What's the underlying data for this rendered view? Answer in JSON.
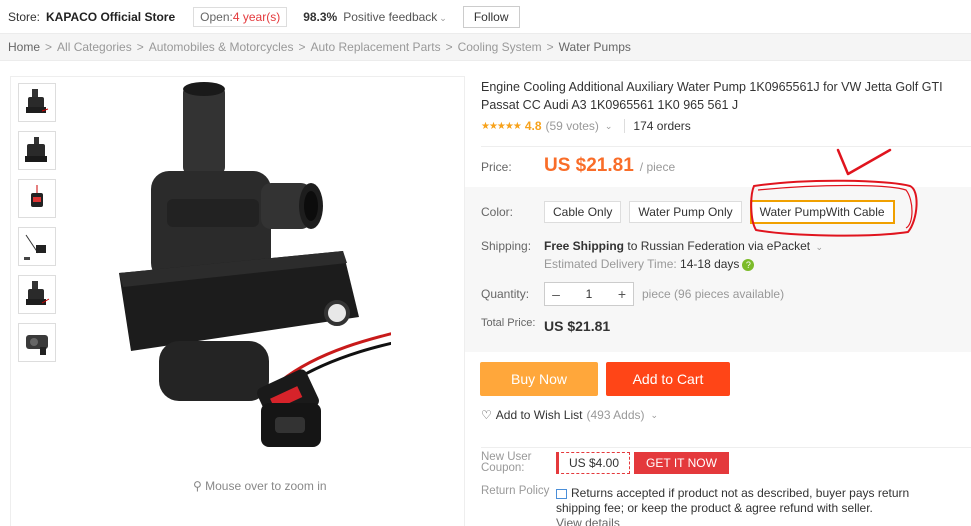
{
  "store": {
    "label": "Store:",
    "name": "KAPACO Official Store",
    "open_prefix": "Open:",
    "open_years": "4 year(s)",
    "feedback_pct": "98.3%",
    "feedback_text": "Positive feedback",
    "follow_label": "Follow"
  },
  "breadcrumb": [
    "Home",
    "All Categories",
    "Automobiles & Motorcycles",
    "Auto Replacement Parts",
    "Cooling System",
    "Water Pumps"
  ],
  "gallery": {
    "zoom_hint": "Mouse over to zoom in"
  },
  "product": {
    "title": "Engine Cooling Additional Auxiliary Water Pump 1K0965561J for VW Jetta Golf GTI Passat CC Audi A3 1K0965561 1K0 965 561 J",
    "rating": "4.8",
    "votes": "(59 votes)",
    "orders": "174 orders",
    "price_label": "Price:",
    "price": "US $21.81",
    "per_piece": "/ piece",
    "color_label": "Color:",
    "color_options": [
      "Cable Only",
      "Water Pump Only",
      "Water PumpWith Cable"
    ],
    "selected_color_index": 2,
    "shipping_label": "Shipping:",
    "shipping_free": "Free Shipping",
    "shipping_to": "to Russian Federation via ePacket",
    "delivery_label": "Estimated Delivery Time:",
    "delivery_days": "14-18 days",
    "quantity_label": "Quantity:",
    "quantity_value": "1",
    "quantity_avail": "piece (96 pieces available)",
    "total_label": "Total Price:",
    "total_value": "US $21.81",
    "buy_now": "Buy Now",
    "add_to_cart": "Add to Cart",
    "wishlist": "Add to Wish List",
    "wishlist_count": "(493 Adds)",
    "coupon_label": "New User Coupon:",
    "coupon_amount": "US $4.00",
    "coupon_get": "GET IT NOW",
    "return_label": "Return Policy",
    "return_text": "Returns accepted if product not as described, buyer pays return shipping fee; or keep the product & agree refund with seller.",
    "view_details": "View details"
  },
  "colors": {
    "price_orange": "#f96d29",
    "buy_now_bg": "#ffa73b",
    "add_cart_bg": "#ff4517",
    "coupon_red": "#e4393c",
    "selected_border": "#f0a000",
    "annotation_red": "#e0141e"
  }
}
